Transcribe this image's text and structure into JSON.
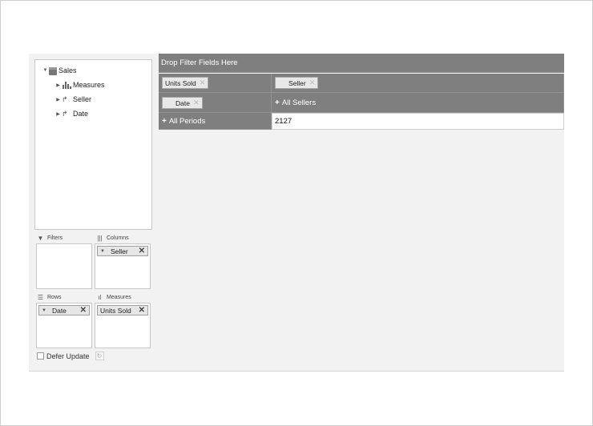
{
  "field_tree": {
    "root": "Sales",
    "children": [
      "Measures",
      "Seller",
      "Date"
    ]
  },
  "zones": {
    "filters": {
      "title": "Filters",
      "fields": []
    },
    "columns": {
      "title": "Columns",
      "fields": [
        "Seller"
      ]
    },
    "rows": {
      "title": "Rows",
      "fields": [
        "Date"
      ]
    },
    "measures": {
      "title": "Measures",
      "fields": [
        "Units Sold"
      ]
    }
  },
  "defer_update": {
    "label": "Defer Update",
    "checked": false
  },
  "pivot": {
    "drop_filter_label": "Drop Filter Fields Here",
    "measure_chip": "Units Sold",
    "column_chip": "Seller",
    "row_chip": "Date",
    "column_total": "All Sellers",
    "row_total": "All Periods",
    "value": "2127"
  },
  "colors": {
    "header_bg": "#7f7f7f",
    "panel_bg": "#f2f2f2"
  }
}
